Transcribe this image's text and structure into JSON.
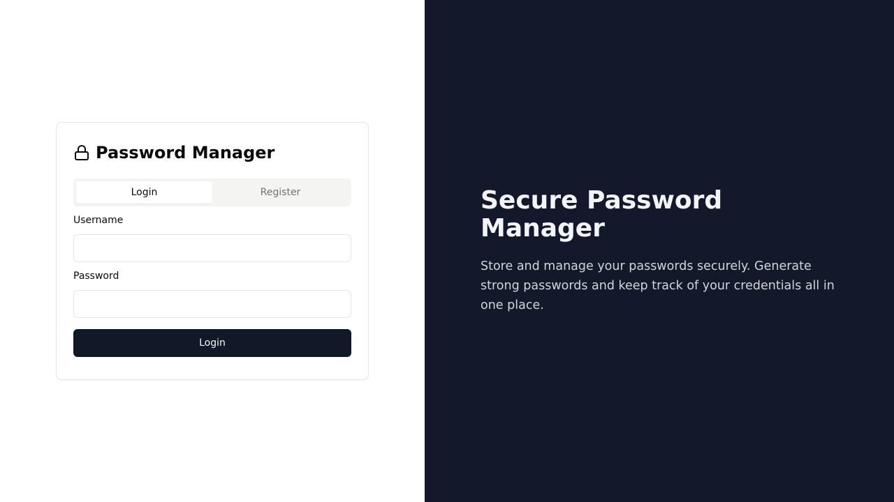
{
  "login_card": {
    "icon": "lock-icon",
    "title": "Password Manager",
    "tabs": [
      {
        "label": "Login",
        "active": true
      },
      {
        "label": "Register",
        "active": false
      }
    ],
    "username": {
      "label": "Username",
      "value": "",
      "placeholder": ""
    },
    "password": {
      "label": "Password",
      "value": "",
      "placeholder": ""
    },
    "submit_label": "Login"
  },
  "hero": {
    "title": "Secure Password Manager",
    "description": "Store and manage your passwords securely. Generate strong passwords and keep track of your credentials all in one place."
  },
  "colors": {
    "primary_button": "#111827",
    "hero_background": "#13192a",
    "tab_track": "#f4f4f3",
    "border": "#e5e5e5"
  }
}
